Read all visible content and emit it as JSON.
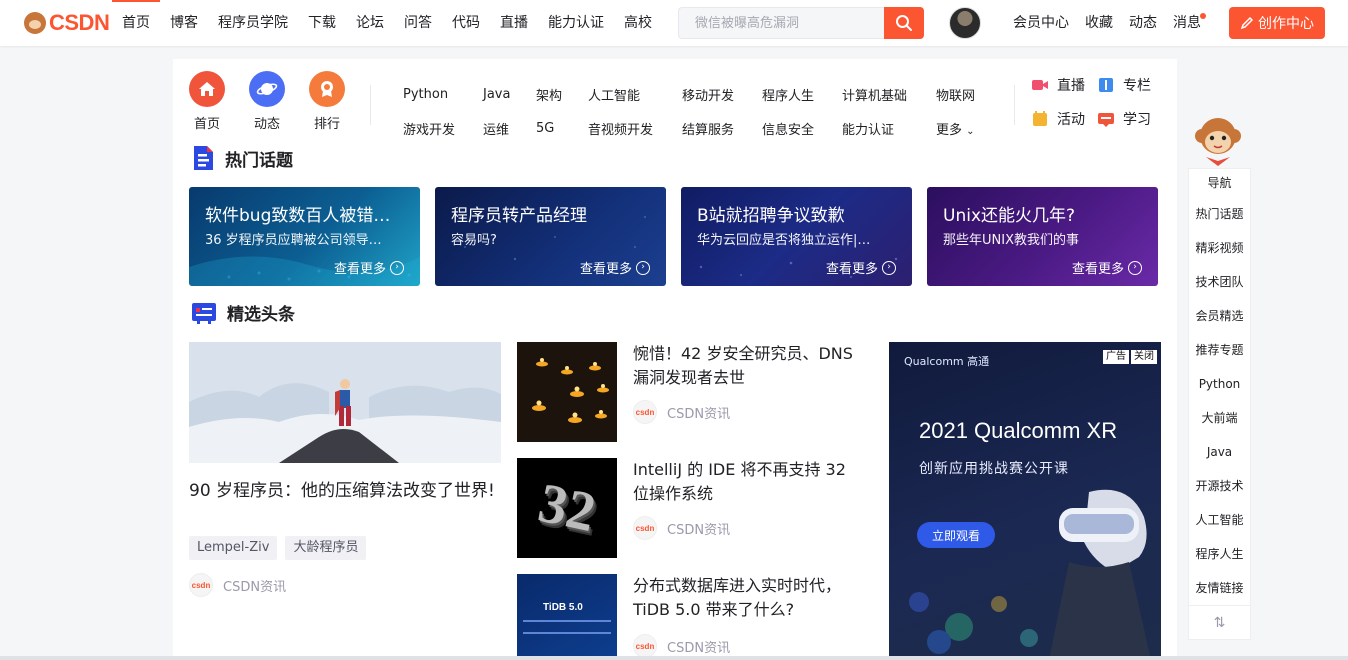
{
  "logo": {
    "text": "CSDN"
  },
  "nav": {
    "items": [
      "首页",
      "博客",
      "程序员学院",
      "下载",
      "论坛",
      "问答",
      "代码",
      "直播",
      "能力认证",
      "高校"
    ]
  },
  "search": {
    "placeholder": "微信被曝高危漏洞"
  },
  "right_nav": {
    "items": [
      "会员中心",
      "收藏",
      "动态",
      "消息"
    ]
  },
  "create_button": "创作中心",
  "quick_links": [
    {
      "label": "首页",
      "icon": "home-icon",
      "color": "#f0553c"
    },
    {
      "label": "动态",
      "icon": "planet-icon",
      "color": "#4c6ef5"
    },
    {
      "label": "排行",
      "icon": "medal-icon",
      "color": "#f57b3c"
    }
  ],
  "categories": {
    "row1": [
      "Python",
      "Java",
      "架构",
      "人工智能",
      "移动开发",
      "程序人生",
      "计算机基础",
      "物联网"
    ],
    "row2": [
      "游戏开发",
      "运维",
      "5G",
      "音视频开发",
      "结算服务",
      "信息安全",
      "能力认证",
      "更多"
    ]
  },
  "extra_links": [
    {
      "label": "直播",
      "icon": "video-icon",
      "color": "#f0506e"
    },
    {
      "label": "专栏",
      "icon": "book-icon",
      "color": "#3e8bf0"
    },
    {
      "label": "活动",
      "icon": "activity-icon",
      "color": "#f5b332"
    },
    {
      "label": "学习",
      "icon": "learn-icon",
      "color": "#f0553c"
    }
  ],
  "hot_topics": {
    "title": "热门话题",
    "more": "查看更多",
    "items": [
      {
        "title": "软件bug致数百人被错误…",
        "subtitle": "36 岁程序员应聘被公司领导…"
      },
      {
        "title": "程序员转产品经理",
        "subtitle": "容易吗?"
      },
      {
        "title": "B站就招聘争议致歉",
        "subtitle": "华为云回应是否将独立运作|…"
      },
      {
        "title": "Unix还能火几年?",
        "subtitle": "那些年UNIX教我们的事"
      }
    ]
  },
  "headlines": {
    "title": "精选头条",
    "featured": {
      "title": "90 岁程序员：他的压缩算法改变了世界!",
      "tags": [
        "Lempel-Ziv",
        "大龄程序员"
      ],
      "source": "CSDN资讯"
    },
    "news": [
      {
        "title": "惋惜！42 岁安全研究员、DNS 漏洞发现者去世",
        "source": "CSDN资讯",
        "thumb": "candles"
      },
      {
        "title": "IntelliJ 的 IDE 将不再支持 32 位操作系统",
        "source": "CSDN资讯",
        "thumb": "32",
        "thumb_text": "32"
      },
      {
        "title": "分布式数据库进入实时时代，TiDB 5.0 带来了什么?",
        "source": "CSDN资讯",
        "thumb": "tidb",
        "thumb_text": "TiDB 5.0"
      }
    ]
  },
  "ad": {
    "brand": "Qualcomm 高通",
    "label_ad": "广告",
    "label_close": "关闭",
    "headline": "2021 Qualcomm XR",
    "subheadline": "创新应用挑战赛公开课",
    "cta": "立即观看"
  },
  "sidebar": {
    "title": "导航",
    "items": [
      "热门话题",
      "精彩视频",
      "技术团队",
      "会员精选",
      "推荐专题",
      "Python",
      "大前端",
      "Java",
      "开源技术",
      "人工智能",
      "程序人生",
      "友情链接"
    ]
  }
}
